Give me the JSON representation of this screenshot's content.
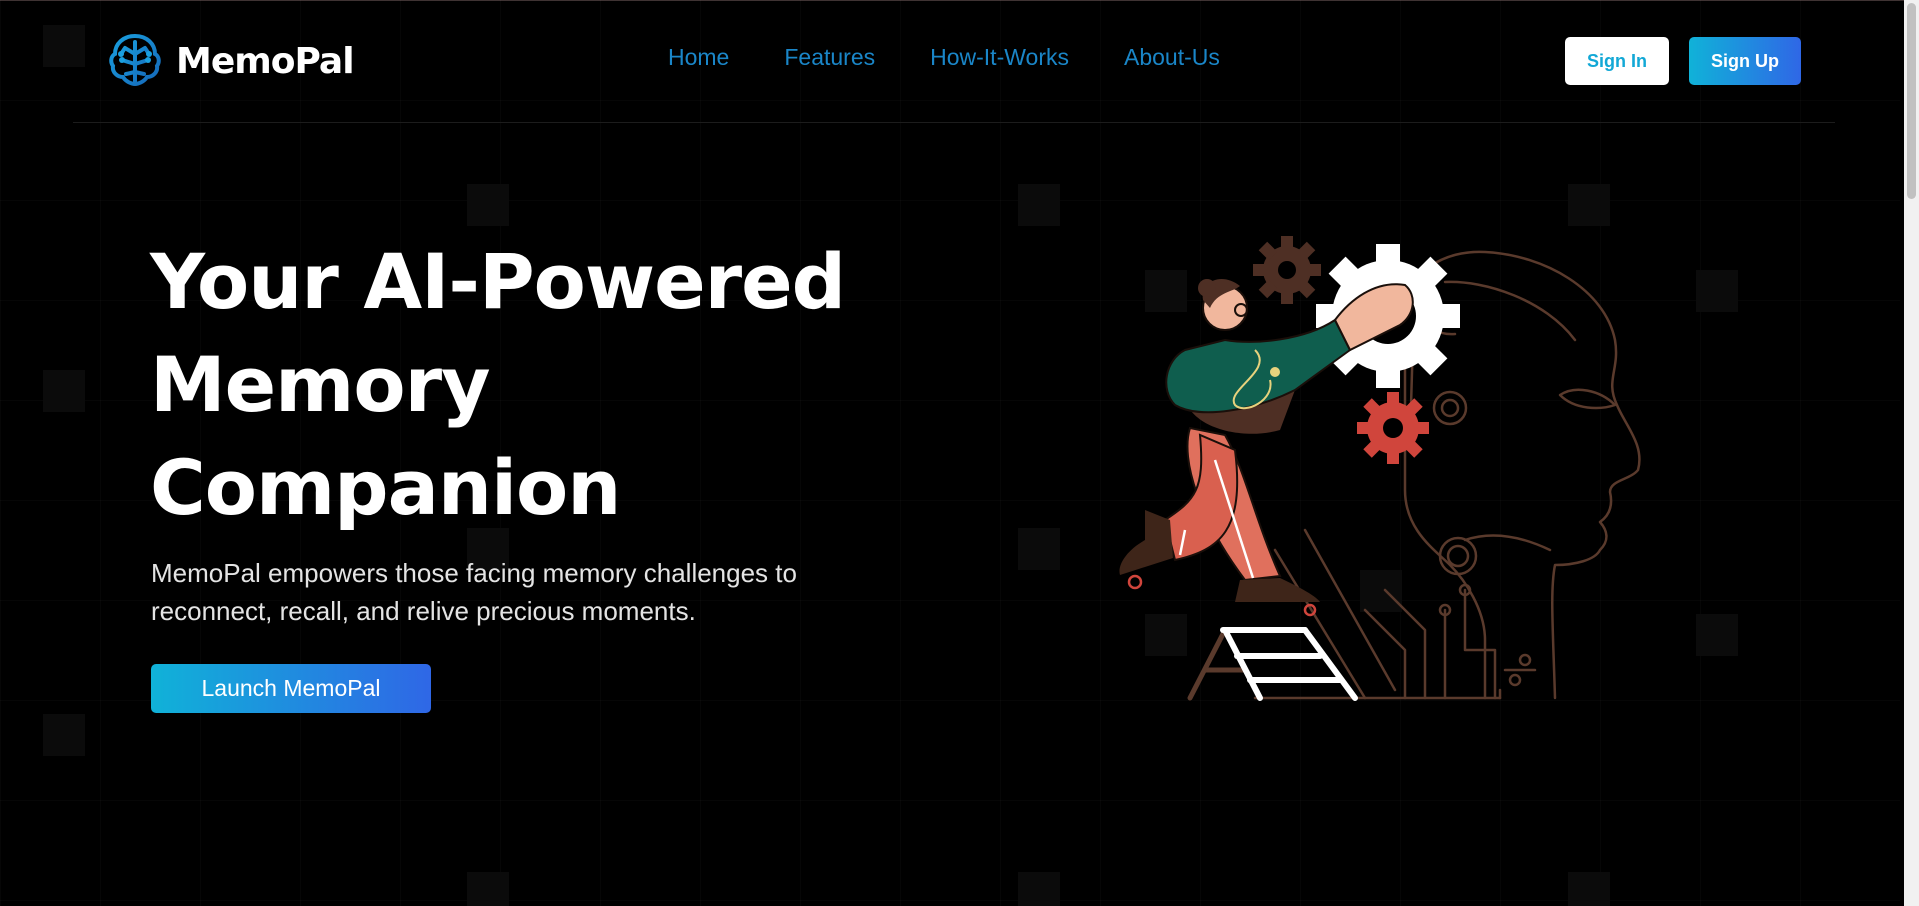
{
  "brand": {
    "name": "MemoPal",
    "logo_icon": "brain-tree-icon",
    "accent_color": "#1a86c8"
  },
  "nav": {
    "items": [
      {
        "label": "Home"
      },
      {
        "label": "Features"
      },
      {
        "label": "How-It-Works"
      },
      {
        "label": "About-Us"
      }
    ]
  },
  "auth": {
    "sign_in_label": "Sign In",
    "sign_up_label": "Sign Up"
  },
  "hero": {
    "title_lines": [
      "Your AI-Powered",
      "Memory",
      "Companion"
    ],
    "subtitle_line1": "MemoPal empowers those facing memory challenges to",
    "subtitle_line2": "reconnect, recall, and relive precious moments.",
    "cta_label": "Launch MemoPal",
    "illustration": "person-fixing-gear-in-ai-head-illustration"
  },
  "colors": {
    "background": "#000000",
    "gradient_start": "#10b2d8",
    "gradient_end": "#2f67e6",
    "signin_text": "#12a8d6"
  }
}
